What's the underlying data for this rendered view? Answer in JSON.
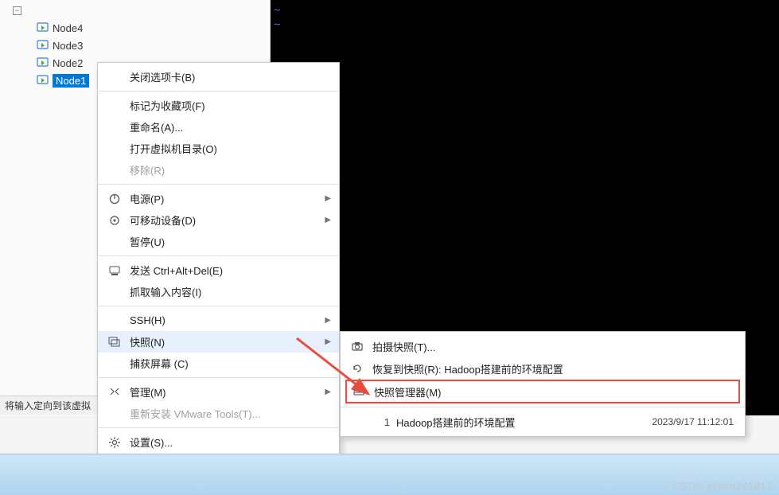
{
  "tree": {
    "nodes": [
      {
        "label": "Node4"
      },
      {
        "label": "Node3"
      },
      {
        "label": "Node2"
      },
      {
        "label": "Node1",
        "selected": true
      }
    ]
  },
  "context_menu": {
    "items": [
      {
        "label": "关闭选项卡(B)",
        "icon": null
      },
      {
        "sep": true
      },
      {
        "label": "标记为收藏项(F)",
        "icon": null
      },
      {
        "label": "重命名(A)...",
        "icon": null
      },
      {
        "label": "打开虚拟机目录(O)",
        "icon": null
      },
      {
        "label": "移除(R)",
        "icon": null,
        "disabled": true
      },
      {
        "sep": true
      },
      {
        "label": "电源(P)",
        "icon": "power-icon",
        "submenu": true
      },
      {
        "label": "可移动设备(D)",
        "icon": "devices-icon",
        "submenu": true
      },
      {
        "label": "暂停(U)",
        "icon": null
      },
      {
        "sep": true
      },
      {
        "label": "发送 Ctrl+Alt+Del(E)",
        "icon": "send-icon"
      },
      {
        "label": "抓取输入内容(I)",
        "icon": null
      },
      {
        "sep": true
      },
      {
        "label": "SSH(H)",
        "icon": null,
        "submenu": true
      },
      {
        "label": "快照(N)",
        "icon": "snapshot-icon",
        "submenu": true,
        "hover": true
      },
      {
        "label": "捕获屏幕 (C)",
        "icon": null
      },
      {
        "sep": true
      },
      {
        "label": "管理(M)",
        "icon": "manage-icon",
        "submenu": true
      },
      {
        "label": "重新安装 VMware Tools(T)...",
        "icon": null,
        "disabled": true
      },
      {
        "sep": true
      },
      {
        "label": "设置(S)...",
        "icon": "settings-icon"
      }
    ]
  },
  "submenu": {
    "items": [
      {
        "label": "拍摄快照(T)...",
        "icon": "camera-icon"
      },
      {
        "label": "恢复到快照(R): Hadoop搭建前的环境配置",
        "icon": "revert-icon"
      },
      {
        "label": "快照管理器(M)",
        "icon": "snap-manager-icon",
        "highlighted": true
      },
      {
        "sep": true
      },
      {
        "index": "1",
        "label": "Hadoop搭建前的环境配置",
        "time": "2023/9/17 11:12:01"
      }
    ]
  },
  "status": {
    "text": "将输入定向到该虚拟"
  },
  "watermark": "CSDN @hsh241817"
}
